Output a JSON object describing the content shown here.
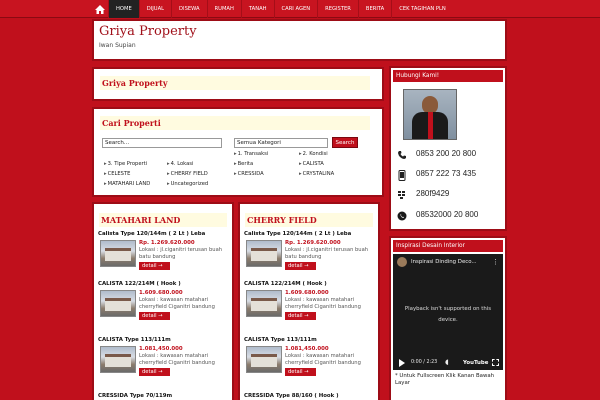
{
  "nav": {
    "home_icon": "home-icon",
    "items": [
      {
        "label": "HOME",
        "active": true
      },
      {
        "label": "DIJUAL"
      },
      {
        "label": "DISEWA"
      },
      {
        "label": "RUMAH"
      },
      {
        "label": "TANAH"
      },
      {
        "label": "CARI AGEN"
      },
      {
        "label": "REGISTER"
      },
      {
        "label": "BERITA"
      },
      {
        "label": "CEK TAGIHAN PLN"
      }
    ]
  },
  "header": {
    "title": "Griya Property",
    "subtitle": "Iwan Supian"
  },
  "griya_box": {
    "title": "Griya Property"
  },
  "search": {
    "title": "Cari Properti",
    "input_value": "Search...",
    "category_value": "Semua Kategori",
    "button_label": "Search",
    "filters": [
      "1. Transaksi",
      "2. Kondisi",
      "3. Tipe Properti",
      "4. Lokasi",
      "Berita",
      "CALISTA",
      "CELESTE",
      "CHERRY FIELD",
      "CRESSIDA",
      "CRYSTALINA",
      "MATAHARI LAND",
      "Uncategorized"
    ]
  },
  "matahari": {
    "title": "MATAHARI LAND",
    "listings": [
      {
        "title": "Calista Type 120/144m ( 2 Lt ) Leba",
        "price": "Rp. 1.269.620.000",
        "location": "Lokasi : jl.ciganitri terusan buah batu bandung",
        "detail": "detail →"
      },
      {
        "title": "CALISTA 122/214M ( Hook )",
        "price": "1.609.680.000",
        "location": "Lokasi : kawasan matahari cherryfield Ciganitri bandung",
        "detail": "detail →"
      },
      {
        "title": "CALISTA Type 113/111m",
        "price": "1.081,450.000",
        "location": "Lokasi : kawasan matahari cherryfield Ciganitri bandung",
        "detail": "detail →"
      },
      {
        "title": "CRESSIDA Type 70/119m"
      }
    ]
  },
  "cherry": {
    "title": "CHERRY FIELD",
    "listings": [
      {
        "title": "Calista Type 120/144m ( 2 Lt ) Leba",
        "price": "Rp. 1.269.620.000",
        "location": "Lokasi : jl.ciganitri terusan buah batu bandung",
        "detail": "detail →"
      },
      {
        "title": "CALISTA 122/214M ( Hook )",
        "price": "1.609.680.000",
        "location": "Lokasi : kawasan matahari cherryfield Ciganitri bandung",
        "detail": "detail →"
      },
      {
        "title": "CALISTA Type 113/111m",
        "price": "1.081,450.000",
        "location": "Lokasi : kawasan matahari cherryfield Ciganitri bandung",
        "detail": "detail →"
      },
      {
        "title": "CRESSIDA Type 88/160 ( Hook )"
      }
    ]
  },
  "contact": {
    "title": "Hubungi Kami!",
    "rows": [
      {
        "icon": "phone-icon",
        "text": "0853 200 20 800"
      },
      {
        "icon": "mobile-icon",
        "text": "0857 222 73 435"
      },
      {
        "icon": "bbm-icon",
        "text": "280f9429"
      },
      {
        "icon": "whatsapp-icon",
        "text": "08532000 20 800"
      }
    ]
  },
  "video": {
    "title": "Inspirasi Desain Interior",
    "video_title": "Inspirasi Dinding Deco...",
    "message": "Playback isn't supported on this device.",
    "time": "0:00 / 2:23",
    "brand": "YouTube",
    "note": "* Untuk Fullscreen Klik Kanan Bawah Layar"
  },
  "colors": {
    "brand_red": "#c0101c",
    "dark_red": "#9d0c16"
  }
}
